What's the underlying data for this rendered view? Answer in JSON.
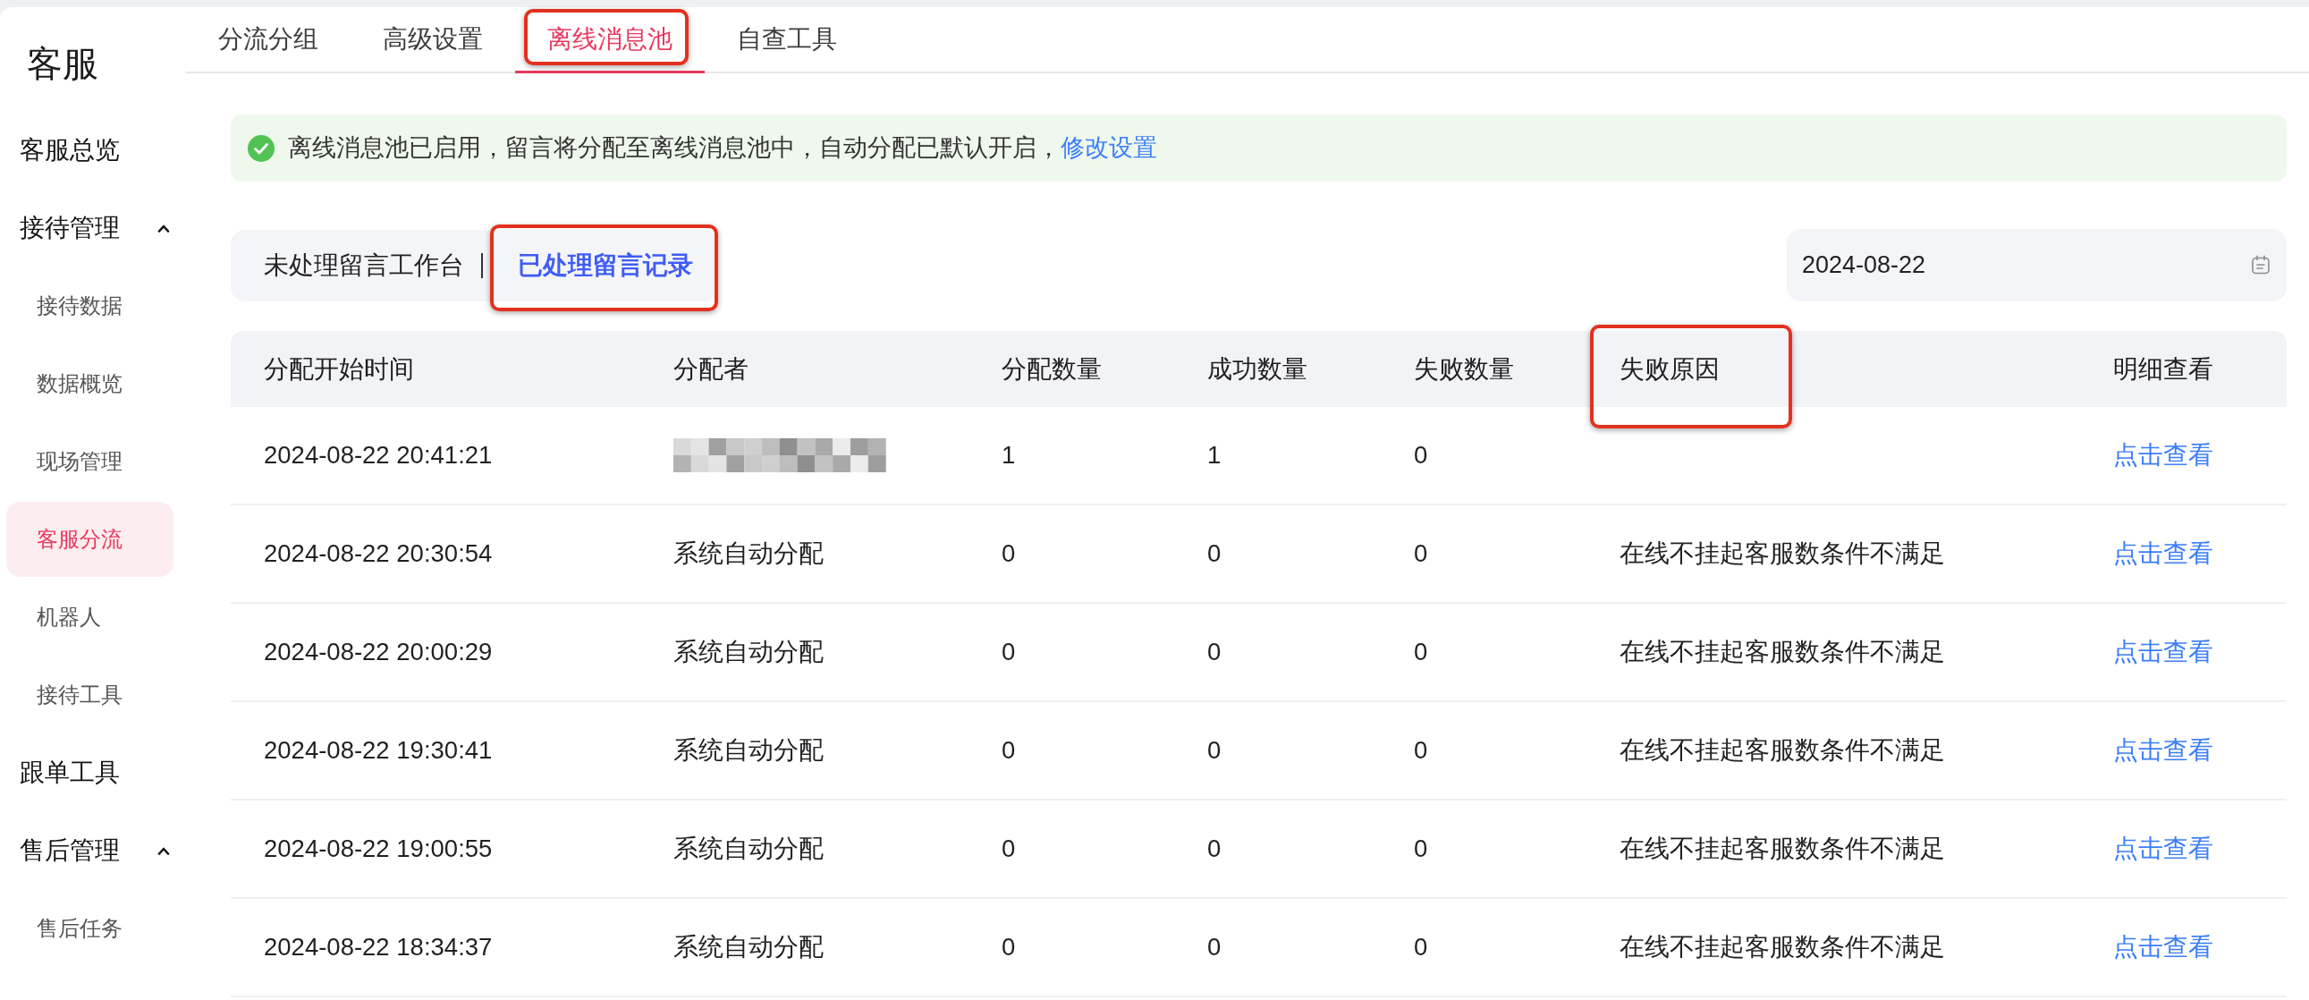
{
  "sidebar": {
    "title": "客服",
    "items": [
      {
        "label": "客服总览",
        "selected": false
      },
      {
        "label": "接待管理",
        "selected": false,
        "expanded": true,
        "children": [
          {
            "label": "接待数据",
            "selected": false
          },
          {
            "label": "数据概览",
            "selected": false
          },
          {
            "label": "现场管理",
            "selected": false
          },
          {
            "label": "客服分流",
            "selected": true
          },
          {
            "label": "机器人",
            "selected": false
          },
          {
            "label": "接待工具",
            "selected": false
          }
        ]
      },
      {
        "label": "跟单工具",
        "selected": false
      },
      {
        "label": "售后管理",
        "selected": false,
        "expanded": true,
        "children": [
          {
            "label": "售后任务",
            "selected": false
          }
        ]
      }
    ]
  },
  "tabs": [
    {
      "label": "分流分组",
      "selected": false,
      "annotated": false
    },
    {
      "label": "高级设置",
      "selected": false,
      "annotated": false
    },
    {
      "label": "离线消息池",
      "selected": true,
      "annotated": true
    },
    {
      "label": "自查工具",
      "selected": false,
      "annotated": false
    }
  ],
  "alert": {
    "message": "离线消息池已启用，留言将分配至离线消息池中，自动分配已默认开启，",
    "link": "修改设置"
  },
  "subtabs": [
    {
      "label": "未处理留言工作台",
      "selected": false,
      "annotated": false
    },
    {
      "label": "已处理留言记录",
      "selected": true,
      "annotated": true
    }
  ],
  "date_filter": {
    "value": "2024-08-22"
  },
  "table": {
    "columns": [
      {
        "label": "分配开始时间",
        "annotated": false
      },
      {
        "label": "分配者",
        "annotated": false
      },
      {
        "label": "分配数量",
        "annotated": false
      },
      {
        "label": "成功数量",
        "annotated": false
      },
      {
        "label": "失败数量",
        "annotated": false
      },
      {
        "label": "失败原因",
        "annotated": true
      },
      {
        "label": "明细查看",
        "annotated": false
      }
    ],
    "rows": [
      {
        "start_time": "2024-08-22 20:41:21",
        "assigner_redacted": true,
        "assigned": "1",
        "succeeded": "1",
        "failed": "0",
        "detail_link": "点击查看"
      },
      {
        "start_time": "2024-08-22 20:30:54",
        "assigner_redacted": false,
        "assigner": "系统自动分配",
        "assigned": "0",
        "succeeded": "0",
        "failed": "0",
        "reason": "在线不挂起客服数条件不满足",
        "detail_link": "点击查看"
      },
      {
        "start_time": "2024-08-22 20:00:29",
        "assigner_redacted": false,
        "assigner": "系统自动分配",
        "assigned": "0",
        "succeeded": "0",
        "failed": "0",
        "reason": "在线不挂起客服数条件不满足",
        "detail_link": "点击查看"
      },
      {
        "start_time": "2024-08-22 19:30:41",
        "assigner_redacted": false,
        "assigner": "系统自动分配",
        "assigned": "0",
        "succeeded": "0",
        "failed": "0",
        "reason": "在线不挂起客服数条件不满足",
        "detail_link": "点击查看"
      },
      {
        "start_time": "2024-08-22 19:00:55",
        "assigner_redacted": false,
        "assigner": "系统自动分配",
        "assigned": "0",
        "succeeded": "0",
        "failed": "0",
        "reason": "在线不挂起客服数条件不满足",
        "detail_link": "点击查看"
      },
      {
        "start_time": "2024-08-22 18:34:37",
        "assigner_redacted": false,
        "assigner": "系统自动分配",
        "assigned": "0",
        "succeeded": "0",
        "failed": "0",
        "reason": "在线不挂起客服数条件不满足",
        "detail_link": "点击查看"
      }
    ]
  }
}
